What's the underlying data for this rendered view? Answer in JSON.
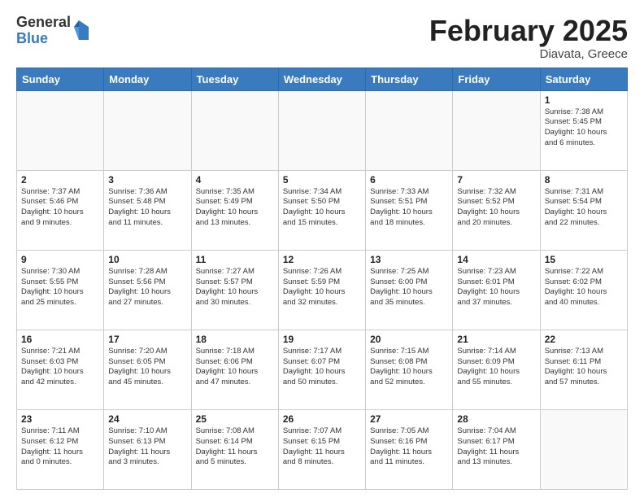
{
  "header": {
    "logo_general": "General",
    "logo_blue": "Blue",
    "month_year": "February 2025",
    "location": "Diavata, Greece"
  },
  "days_of_week": [
    "Sunday",
    "Monday",
    "Tuesday",
    "Wednesday",
    "Thursday",
    "Friday",
    "Saturday"
  ],
  "weeks": [
    [
      {
        "day": "",
        "info": ""
      },
      {
        "day": "",
        "info": ""
      },
      {
        "day": "",
        "info": ""
      },
      {
        "day": "",
        "info": ""
      },
      {
        "day": "",
        "info": ""
      },
      {
        "day": "",
        "info": ""
      },
      {
        "day": "1",
        "info": "Sunrise: 7:38 AM\nSunset: 5:45 PM\nDaylight: 10 hours\nand 6 minutes."
      }
    ],
    [
      {
        "day": "2",
        "info": "Sunrise: 7:37 AM\nSunset: 5:46 PM\nDaylight: 10 hours\nand 9 minutes."
      },
      {
        "day": "3",
        "info": "Sunrise: 7:36 AM\nSunset: 5:48 PM\nDaylight: 10 hours\nand 11 minutes."
      },
      {
        "day": "4",
        "info": "Sunrise: 7:35 AM\nSunset: 5:49 PM\nDaylight: 10 hours\nand 13 minutes."
      },
      {
        "day": "5",
        "info": "Sunrise: 7:34 AM\nSunset: 5:50 PM\nDaylight: 10 hours\nand 15 minutes."
      },
      {
        "day": "6",
        "info": "Sunrise: 7:33 AM\nSunset: 5:51 PM\nDaylight: 10 hours\nand 18 minutes."
      },
      {
        "day": "7",
        "info": "Sunrise: 7:32 AM\nSunset: 5:52 PM\nDaylight: 10 hours\nand 20 minutes."
      },
      {
        "day": "8",
        "info": "Sunrise: 7:31 AM\nSunset: 5:54 PM\nDaylight: 10 hours\nand 22 minutes."
      }
    ],
    [
      {
        "day": "9",
        "info": "Sunrise: 7:30 AM\nSunset: 5:55 PM\nDaylight: 10 hours\nand 25 minutes."
      },
      {
        "day": "10",
        "info": "Sunrise: 7:28 AM\nSunset: 5:56 PM\nDaylight: 10 hours\nand 27 minutes."
      },
      {
        "day": "11",
        "info": "Sunrise: 7:27 AM\nSunset: 5:57 PM\nDaylight: 10 hours\nand 30 minutes."
      },
      {
        "day": "12",
        "info": "Sunrise: 7:26 AM\nSunset: 5:59 PM\nDaylight: 10 hours\nand 32 minutes."
      },
      {
        "day": "13",
        "info": "Sunrise: 7:25 AM\nSunset: 6:00 PM\nDaylight: 10 hours\nand 35 minutes."
      },
      {
        "day": "14",
        "info": "Sunrise: 7:23 AM\nSunset: 6:01 PM\nDaylight: 10 hours\nand 37 minutes."
      },
      {
        "day": "15",
        "info": "Sunrise: 7:22 AM\nSunset: 6:02 PM\nDaylight: 10 hours\nand 40 minutes."
      }
    ],
    [
      {
        "day": "16",
        "info": "Sunrise: 7:21 AM\nSunset: 6:03 PM\nDaylight: 10 hours\nand 42 minutes."
      },
      {
        "day": "17",
        "info": "Sunrise: 7:20 AM\nSunset: 6:05 PM\nDaylight: 10 hours\nand 45 minutes."
      },
      {
        "day": "18",
        "info": "Sunrise: 7:18 AM\nSunset: 6:06 PM\nDaylight: 10 hours\nand 47 minutes."
      },
      {
        "day": "19",
        "info": "Sunrise: 7:17 AM\nSunset: 6:07 PM\nDaylight: 10 hours\nand 50 minutes."
      },
      {
        "day": "20",
        "info": "Sunrise: 7:15 AM\nSunset: 6:08 PM\nDaylight: 10 hours\nand 52 minutes."
      },
      {
        "day": "21",
        "info": "Sunrise: 7:14 AM\nSunset: 6:09 PM\nDaylight: 10 hours\nand 55 minutes."
      },
      {
        "day": "22",
        "info": "Sunrise: 7:13 AM\nSunset: 6:11 PM\nDaylight: 10 hours\nand 57 minutes."
      }
    ],
    [
      {
        "day": "23",
        "info": "Sunrise: 7:11 AM\nSunset: 6:12 PM\nDaylight: 11 hours\nand 0 minutes."
      },
      {
        "day": "24",
        "info": "Sunrise: 7:10 AM\nSunset: 6:13 PM\nDaylight: 11 hours\nand 3 minutes."
      },
      {
        "day": "25",
        "info": "Sunrise: 7:08 AM\nSunset: 6:14 PM\nDaylight: 11 hours\nand 5 minutes."
      },
      {
        "day": "26",
        "info": "Sunrise: 7:07 AM\nSunset: 6:15 PM\nDaylight: 11 hours\nand 8 minutes."
      },
      {
        "day": "27",
        "info": "Sunrise: 7:05 AM\nSunset: 6:16 PM\nDaylight: 11 hours\nand 11 minutes."
      },
      {
        "day": "28",
        "info": "Sunrise: 7:04 AM\nSunset: 6:17 PM\nDaylight: 11 hours\nand 13 minutes."
      },
      {
        "day": "",
        "info": ""
      }
    ]
  ]
}
